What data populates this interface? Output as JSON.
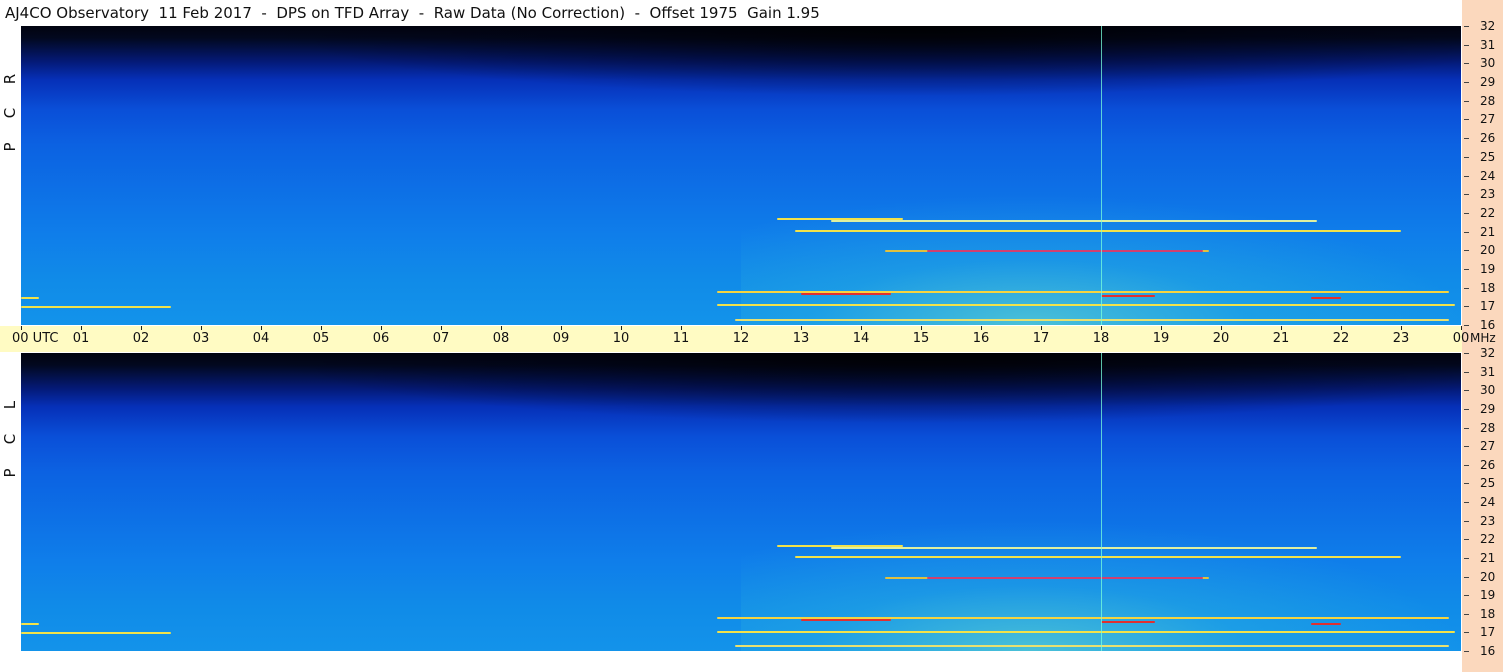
{
  "title": "AJ4CO Observatory  11 Feb 2017  -  DPS on TFD Array  -  Raw Data (No Correction)  -  Offset 1975  Gain 1.95",
  "panels": [
    {
      "label_letters": [
        "R",
        "C",
        "P"
      ]
    },
    {
      "label_letters": [
        "L",
        "C",
        "P"
      ]
    }
  ],
  "time_axis": {
    "labels": [
      "00  UTC",
      "01",
      "02",
      "03",
      "04",
      "05",
      "06",
      "07",
      "08",
      "09",
      "10",
      "11",
      "12",
      "13",
      "14",
      "15",
      "16",
      "17",
      "18",
      "19",
      "20",
      "21",
      "22",
      "23",
      "00"
    ],
    "unit_label": "MHz"
  },
  "freq_axis": {
    "labels": [
      "32",
      "31",
      "30",
      "29",
      "28",
      "27",
      "26",
      "25",
      "24",
      "23",
      "22",
      "21",
      "20",
      "19",
      "18",
      "17",
      "16"
    ]
  },
  "chart_data": {
    "type": "heatmap",
    "title": "AJ4CO Observatory  11 Feb 2017  -  DPS on TFD Array  -  Raw Data (No Correction)  -  Offset 1975  Gain 1.95",
    "x": [
      "00",
      "01",
      "02",
      "03",
      "04",
      "05",
      "06",
      "07",
      "08",
      "09",
      "10",
      "11",
      "12",
      "13",
      "14",
      "15",
      "16",
      "17",
      "18",
      "19",
      "20",
      "21",
      "22",
      "23",
      "00"
    ],
    "xlabel": "UTC",
    "ylabel": "MHz",
    "ylim": [
      16,
      32
    ],
    "series": [
      {
        "name": "RCP"
      },
      {
        "name": "LCP"
      }
    ],
    "colors": {
      "low": "#01030f",
      "mid": "#0a4fd8",
      "high": "#1393ea",
      "hot": "#f2e24a",
      "peak": "#e03030"
    },
    "streaks": [
      {
        "t0": 12.6,
        "t1": 14.7,
        "mhz": 21.7,
        "color": "#f2e24a"
      },
      {
        "t0": 13.5,
        "t1": 21.6,
        "mhz": 21.6,
        "color": "#dff0a0"
      },
      {
        "t0": 12.9,
        "t1": 23.0,
        "mhz": 21.1,
        "color": "#f2e24a"
      },
      {
        "t0": 14.4,
        "t1": 19.8,
        "mhz": 20.0,
        "color": "#e0c040"
      },
      {
        "t0": 15.1,
        "t1": 19.7,
        "mhz": 20.0,
        "color": "#d04070"
      },
      {
        "t0": 11.6,
        "t1": 23.8,
        "mhz": 17.8,
        "color": "#f5d440"
      },
      {
        "t0": 13.0,
        "t1": 14.5,
        "mhz": 17.7,
        "color": "#e03030"
      },
      {
        "t0": 18.0,
        "t1": 18.9,
        "mhz": 17.6,
        "color": "#e03030"
      },
      {
        "t0": 21.5,
        "t1": 22.0,
        "mhz": 17.5,
        "color": "#e03030"
      },
      {
        "t0": 11.6,
        "t1": 23.9,
        "mhz": 17.1,
        "color": "#f2e24a"
      },
      {
        "t0": 0.0,
        "t1": 2.5,
        "mhz": 17.0,
        "color": "#f2e24a"
      },
      {
        "t0": 0.0,
        "t1": 0.3,
        "mhz": 17.5,
        "color": "#f2e24a"
      },
      {
        "t0": 11.9,
        "t1": 23.8,
        "mhz": 16.3,
        "color": "#e8e070"
      }
    ],
    "vertical_line_utc": 18.0
  }
}
